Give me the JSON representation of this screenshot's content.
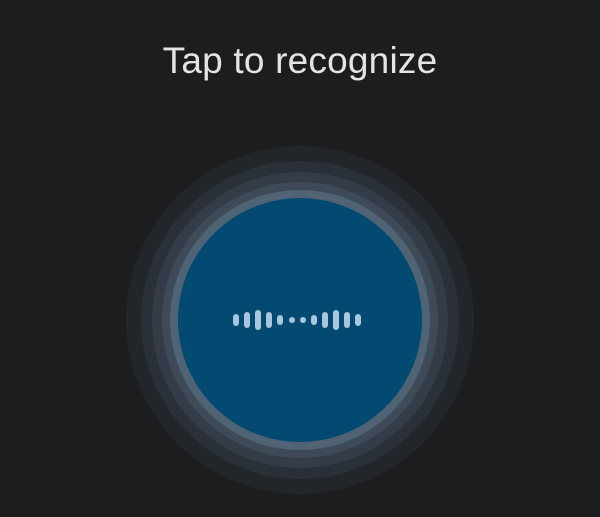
{
  "header": {
    "title": "Tap to recognize"
  },
  "mic_button": {
    "icon": "sound-wave-icon",
    "color": "#024a72",
    "wave_color": "#a9c6dc"
  },
  "colors": {
    "background": "#1c1d1f",
    "title": "#e4e4e6"
  }
}
